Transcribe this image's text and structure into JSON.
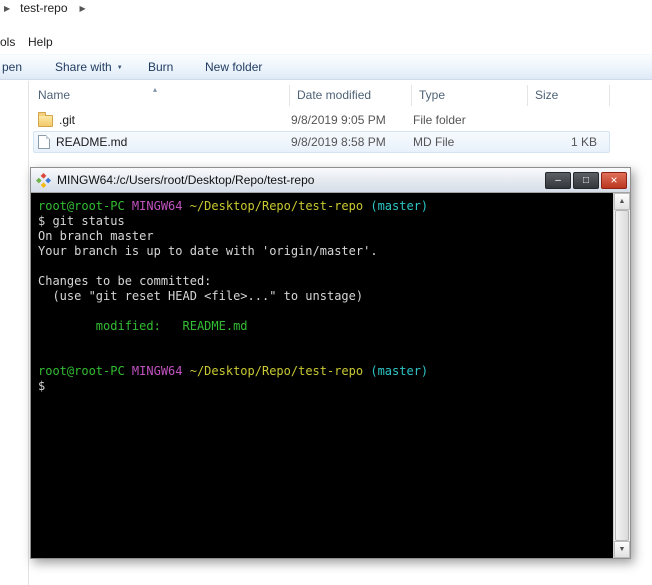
{
  "icons": {
    "breadcrumb_arrow": "▶",
    "dropdown_arrow": "▼",
    "sort_asc": "▴",
    "scroll_up": "▲",
    "scroll_down": "▼"
  },
  "explorer": {
    "breadcrumb": {
      "item": "test-repo"
    },
    "menubar": {
      "tools_partial": "ols",
      "help": "Help"
    },
    "toolbar": {
      "open_partial": "pen",
      "share_with": "Share with",
      "burn": "Burn",
      "new_folder": "New folder"
    },
    "columns": {
      "name": "Name",
      "date_modified": "Date modified",
      "type": "Type",
      "size": "Size"
    },
    "files": [
      {
        "name": ".git",
        "date_modified": "9/8/2019 9:05 PM",
        "type": "File folder",
        "size": "",
        "icon": "folder-icon",
        "selected": false
      },
      {
        "name": "README.md",
        "date_modified": "9/8/2019 8:58 PM",
        "type": "MD File",
        "size": "1 KB",
        "icon": "file-icon",
        "selected": true
      }
    ]
  },
  "terminal": {
    "title": "MINGW64:/c/Users/root/Desktop/Repo/test-repo",
    "controls": {
      "minimize": "–",
      "maximize": "□",
      "close": "×"
    },
    "colors": {
      "green": "#33bd33",
      "magenta": "#c153c1",
      "yellow": "#c9c932",
      "cyan": "#2ec6c6",
      "default": "#d6d6d6"
    },
    "lines": [
      [
        {
          "t": "root@root-PC ",
          "c": "green"
        },
        {
          "t": "MINGW64 ",
          "c": "magenta"
        },
        {
          "t": "~/Desktop/Repo/test-repo ",
          "c": "yellow"
        },
        {
          "t": "(master)",
          "c": "cyan"
        }
      ],
      [
        {
          "t": "$ git status",
          "c": "default"
        }
      ],
      [
        {
          "t": "On branch master",
          "c": "default"
        }
      ],
      [
        {
          "t": "Your branch is up to date with 'origin/master'.",
          "c": "default"
        }
      ],
      [],
      [
        {
          "t": "Changes to be committed:",
          "c": "default"
        }
      ],
      [
        {
          "t": "  (use \"git reset HEAD <file>...\" to unstage)",
          "c": "default"
        }
      ],
      [],
      [
        {
          "t": "        modified:   README.md",
          "c": "green"
        }
      ],
      [],
      [],
      [
        {
          "t": "root@root-PC ",
          "c": "green"
        },
        {
          "t": "MINGW64 ",
          "c": "magenta"
        },
        {
          "t": "~/Desktop/Repo/test-repo ",
          "c": "yellow"
        },
        {
          "t": "(master)",
          "c": "cyan"
        }
      ],
      [
        {
          "t": "$",
          "c": "default"
        }
      ]
    ]
  }
}
